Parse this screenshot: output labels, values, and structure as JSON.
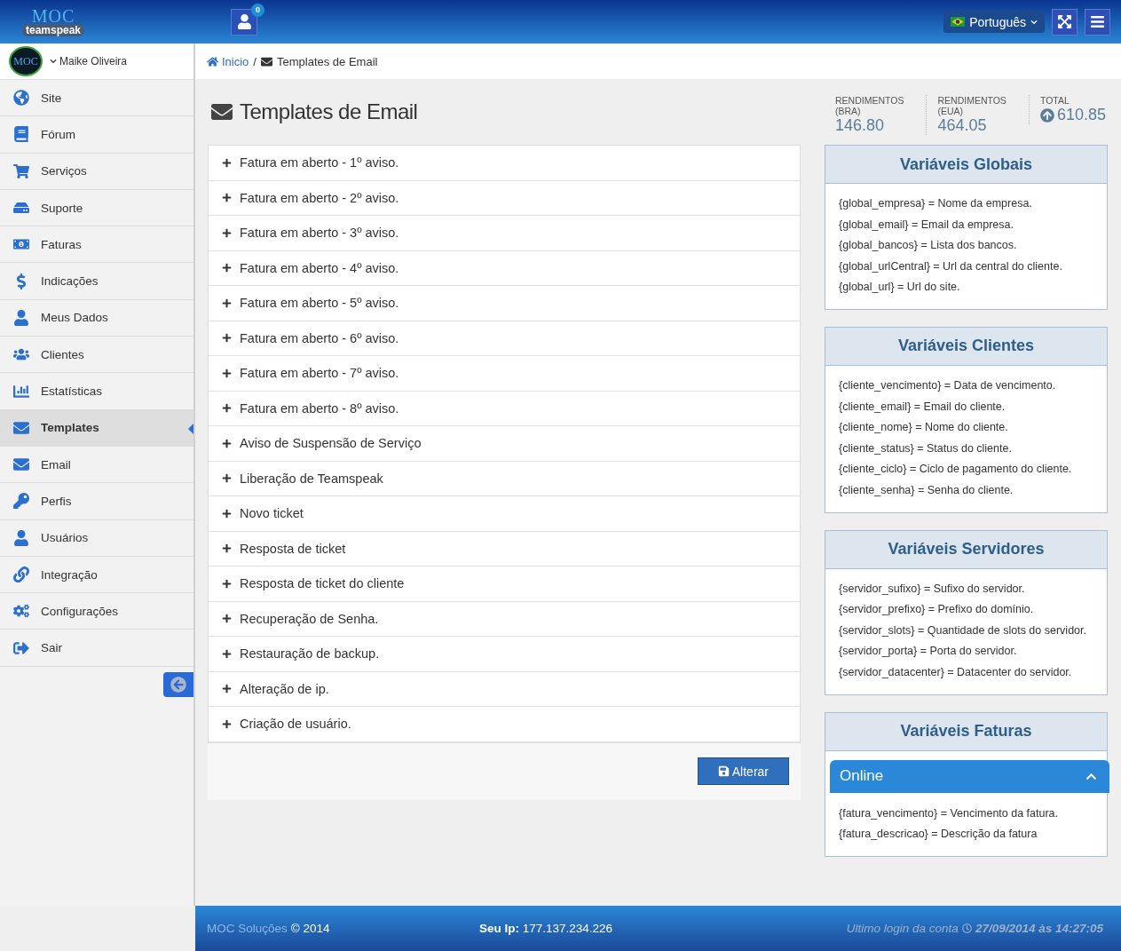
{
  "header": {
    "logo_top": "MOC",
    "logo_bottom": "teamspeak",
    "notifications": "0",
    "language": "Português"
  },
  "sidebar": {
    "user": {
      "avatar": "MOC",
      "name": "Maike Oliveira"
    },
    "items": [
      {
        "label": "Site",
        "selected": false
      },
      {
        "label": "Fórum",
        "selected": false
      },
      {
        "label": "Serviços",
        "selected": false
      },
      {
        "label": "Suporte",
        "selected": false
      },
      {
        "label": "Faturas",
        "selected": false
      },
      {
        "label": "Indicações",
        "selected": false
      },
      {
        "label": "Meus Dados",
        "selected": false
      },
      {
        "label": "Clientes",
        "selected": false
      },
      {
        "label": "Estatísticas",
        "selected": false
      },
      {
        "label": "Templates",
        "selected": true
      },
      {
        "label": "Email",
        "selected": false
      },
      {
        "label": "Perfis",
        "selected": false
      },
      {
        "label": "Usuários",
        "selected": false
      },
      {
        "label": "Integração",
        "selected": false
      },
      {
        "label": "Configurações",
        "selected": false
      },
      {
        "label": "Sair",
        "selected": false
      }
    ]
  },
  "breadcrumb": {
    "home": "Inicio",
    "separator": "/",
    "current": "Templates de Email"
  },
  "page_title": "Templates de Email",
  "stats": [
    {
      "label": "RENDIMENTOS (BRA)",
      "value": "146.80",
      "kind": "amount"
    },
    {
      "label": "RENDIMENTOS (EUA)",
      "value": "464.05",
      "kind": "amount"
    },
    {
      "label": "TOTAL",
      "value": "610.85",
      "kind": "total"
    }
  ],
  "templates": [
    "Fatura em aberto - 1º aviso.",
    "Fatura em aberto - 2º aviso.",
    "Fatura em aberto - 3º aviso.",
    "Fatura em aberto - 4º aviso.",
    "Fatura em aberto - 5º aviso.",
    "Fatura em aberto - 6º aviso.",
    "Fatura em aberto - 7º aviso.",
    "Fatura em aberto - 8º aviso.",
    "Aviso de Suspensão de Serviço",
    "Liberação de Teamspeak",
    "Novo ticket",
    "Resposta de ticket",
    "Resposta de ticket do cliente",
    "Recuperação de Senha.",
    "Restauração de backup.",
    "Alteração de ip.",
    "Criação de usuário."
  ],
  "save_button": "Alterar",
  "variable_cards": [
    {
      "title": "Variáveis Globais",
      "lines": [
        "{global_empresa} = Nome da empresa.",
        "{global_email} = Email da empresa.",
        "{global_bancos} = Lista dos bancos.",
        "{global_urlCentral} = Url da central do cliente.",
        "{global_url} = Url do site."
      ]
    },
    {
      "title": "Variáveis Clientes",
      "lines": [
        "{cliente_vencimento} = Data de vencimento.",
        "{cliente_email} = Email do cliente.",
        "{cliente_nome} = Nome do cliente.",
        "{cliente_status} = Status do cliente.",
        "{cliente_ciclo} = Ciclo de pagamento do cliente.",
        "{cliente_senha} = Senha do cliente."
      ]
    },
    {
      "title": "Variáveis Servidores",
      "lines": [
        "{servidor_sufixo} = Sufixo do servidor.",
        "{servidor_prefixo} = Prefixo do domínio.",
        "{servidor_slots} = Quantidade de slots do servidor.",
        "{servidor_porta} = Porta do servidor.",
        "{servidor_datacenter} = Datacenter do servidor."
      ]
    },
    {
      "title": "Variáveis Faturas",
      "lines": [
        "{fatura_vencimento} = Vencimento da fatura.",
        "{fatura_descricao} = Descrição da fatura"
      ]
    }
  ],
  "chat": {
    "title": "Online",
    "expanded": true
  },
  "footer": {
    "company": "MOC Soluções",
    "copyright": "© 2014",
    "ip_label": "Seu Ip:",
    "ip": "177.137.234.226",
    "last_login_label": "Ultimo login da conta",
    "last_login": "27/09/2014 às 14:27:05"
  }
}
